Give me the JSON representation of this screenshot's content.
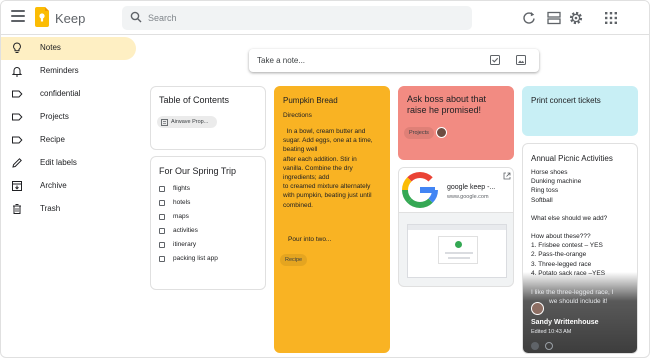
{
  "app": {
    "name": "Keep"
  },
  "colors": {
    "accent": "#fbbc04",
    "active_nav_bg": "#feefc3",
    "note_orange": "#f9b323",
    "note_red": "#f28b82",
    "note_blue": "#c8eff5"
  },
  "search": {
    "placeholder": "Search"
  },
  "header_icons": [
    "refresh-icon",
    "list-view-icon",
    "settings-icon",
    "apps-grid-icon"
  ],
  "sidebar": {
    "items": [
      {
        "label": "Notes",
        "icon": "lightbulb-icon",
        "active": true
      },
      {
        "label": "Reminders",
        "icon": "bell-icon"
      },
      {
        "label": "confidential",
        "icon": "label-icon"
      },
      {
        "label": "Projects",
        "icon": "label-icon"
      },
      {
        "label": "Recipe",
        "icon": "label-icon"
      },
      {
        "label": "Edit labels",
        "icon": "pencil-icon"
      },
      {
        "label": "Archive",
        "icon": "archive-icon"
      },
      {
        "label": "Trash",
        "icon": "trash-icon"
      }
    ]
  },
  "take_note": {
    "text": "Take a note..."
  },
  "notes": {
    "toc": {
      "title": "Table of Contents",
      "chip": "Airwave Prop..."
    },
    "trip": {
      "title": "For Our Spring Trip",
      "items": [
        "flights",
        "hotels",
        "maps",
        "activities",
        "itinerary",
        "packing list app"
      ]
    },
    "pumpkin": {
      "title": "Pumpkin Bread",
      "subtitle": "Directions",
      "lines": [
        "  In a bowl, cream butter and",
        "sugar. Add eggs, one at a time,",
        "beating well",
        "after each addition. Stir in",
        "vanilla. Combine the dry",
        "ingredients; add",
        "to creamed mixture alternately",
        "with pumpkin, beating just until",
        "combined."
      ],
      "pour": "Pour into two...",
      "label": "Recipe"
    },
    "boss": {
      "title_line1": "Ask boss about that",
      "title_line2": "raise he promised!",
      "label": "Projects"
    },
    "link": {
      "title": "google keep -...",
      "url": "www.google.com"
    },
    "concert": {
      "title": "Print concert tickets"
    },
    "picnic": {
      "title": "Annual Picnic Activities",
      "lines": [
        "Horse shoes",
        "Dunking machine",
        "Ring toss",
        "Softball"
      ],
      "question": "What else should we add?",
      "howabout": "How about these???",
      "list": [
        "1. Frisbee contest – YES",
        "2. Pass-the-orange",
        "3. Three-legged race",
        "4. Potato sack race –YES"
      ],
      "tail1": "I like the three-legged race, I",
      "tail2": "we should include it!",
      "collaborator": "Sandy Writtenhouse",
      "edited": "Edited 10:43 AM"
    }
  }
}
